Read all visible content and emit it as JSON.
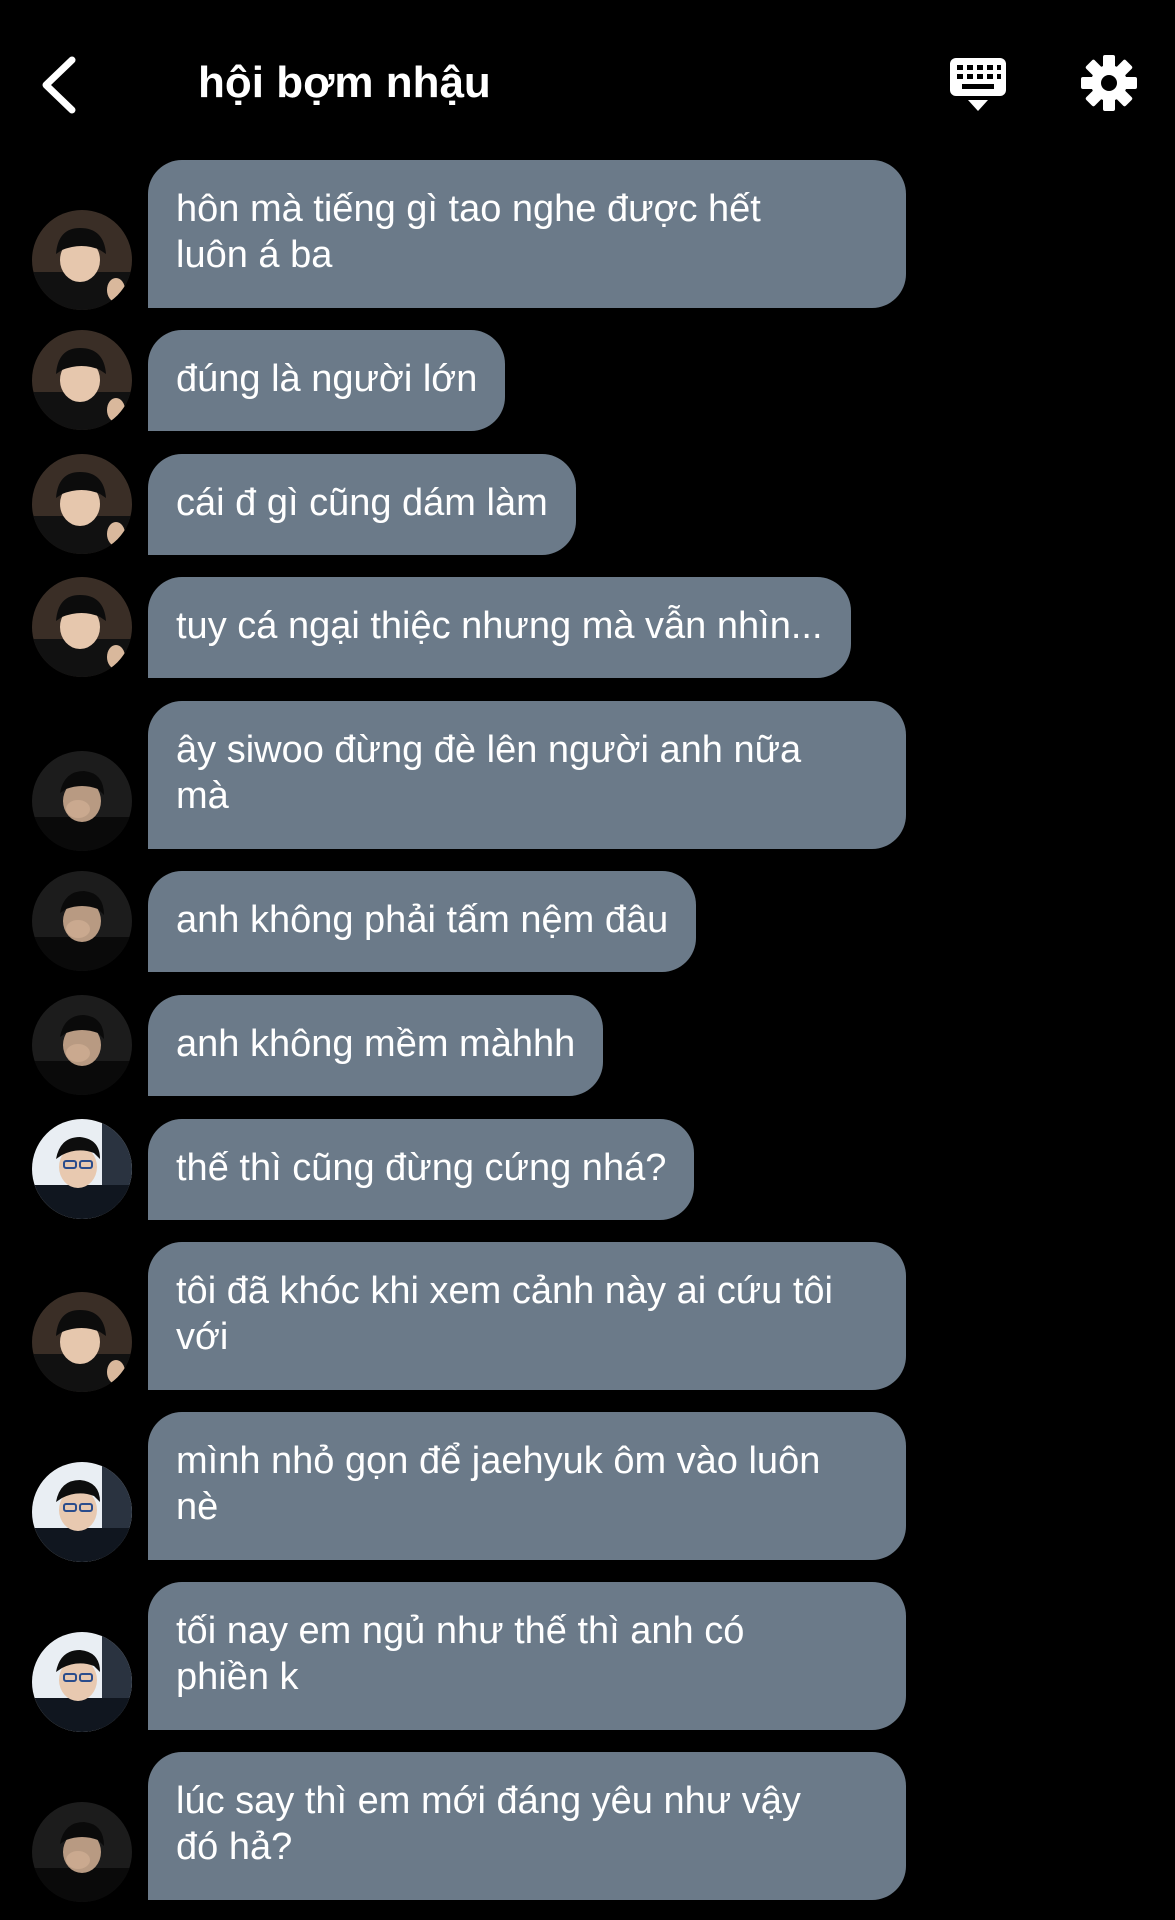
{
  "header": {
    "back_icon": "chevron-left-icon",
    "title": "hội bợm nhậu",
    "keyboard_icon": "keyboard-icon",
    "settings_icon": "gear-icon"
  },
  "colors": {
    "background": "#000000",
    "bubble": "#6b7a89",
    "text": "#ffffff"
  },
  "messages": [
    {
      "avatar": "avatar-a",
      "text": "hôn mà tiếng gì tao nghe được hết\nluôn á ba"
    },
    {
      "avatar": "avatar-a",
      "text": "đúng là người lớn"
    },
    {
      "avatar": "avatar-a",
      "text": "cái đ gì cũng dám làm"
    },
    {
      "avatar": "avatar-a",
      "text": "tuy cá ngại thiệc nhưng mà vẫn nhìn..."
    },
    {
      "avatar": "avatar-b",
      "text": "ây siwoo đừng đè lên người anh nữa\nmà"
    },
    {
      "avatar": "avatar-b",
      "text": "anh không phải tấm nệm đâu"
    },
    {
      "avatar": "avatar-b",
      "text": "anh không mềm màhhh"
    },
    {
      "avatar": "avatar-c",
      "text": "thế thì cũng đừng cứng nhá?"
    },
    {
      "avatar": "avatar-a",
      "text": "tôi đã khóc khi xem cảnh này ai cứu tôi\nvới"
    },
    {
      "avatar": "avatar-c",
      "text": "mình nhỏ gọn để jaehyuk ôm vào luôn\nnè"
    },
    {
      "avatar": "avatar-c",
      "text": "tối nay em ngủ như thế thì anh có\nphiền k"
    },
    {
      "avatar": "avatar-b",
      "text": "lúc say thì em mới đáng yêu như vậy\nđó hả?"
    }
  ]
}
